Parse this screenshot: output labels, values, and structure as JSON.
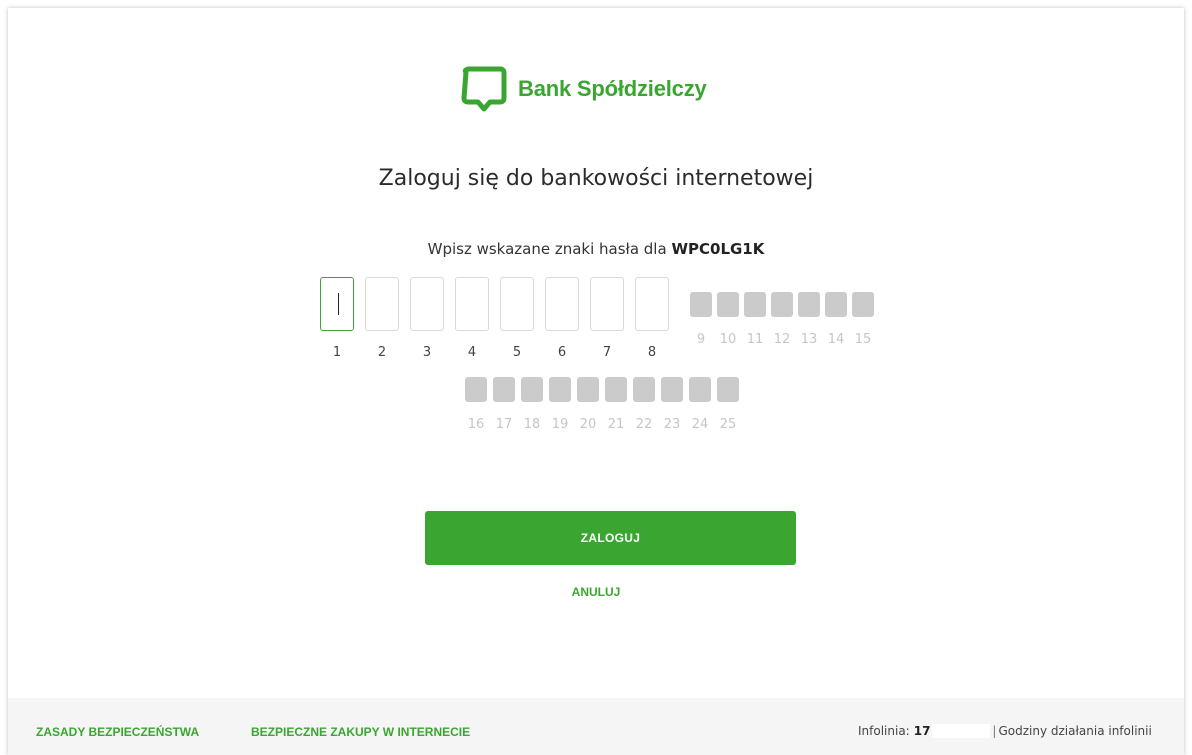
{
  "brand": {
    "name": "Bank Spółdzielczy",
    "color": "#3aa631",
    "logo_icon": "bank-logo-icon"
  },
  "login": {
    "title": "Zaloguj się do bankowości internetowej",
    "subtitle_prefix": "Wpisz wskazane znaki hasła dla",
    "username": "WPC0LG1K",
    "active_fields": [
      "1",
      "2",
      "3",
      "4",
      "5",
      "6",
      "7",
      "8"
    ],
    "disabled_fields_row1": [
      "9",
      "10",
      "11",
      "12",
      "13",
      "14",
      "15"
    ],
    "disabled_fields_row2": [
      "16",
      "17",
      "18",
      "19",
      "20",
      "21",
      "22",
      "23",
      "24",
      "25"
    ],
    "login_button": "ZALOGUJ",
    "cancel_link": "ANULUJ"
  },
  "footer": {
    "link_security": "ZASADY BEZPIECZEŃSTWA",
    "link_shopping": "BEZPIECZNE ZAKUPY W INTERNECIE",
    "infoline_label": "Infolinia:",
    "infoline_number": "17",
    "hours_label": "Godziny działania infolinii"
  }
}
